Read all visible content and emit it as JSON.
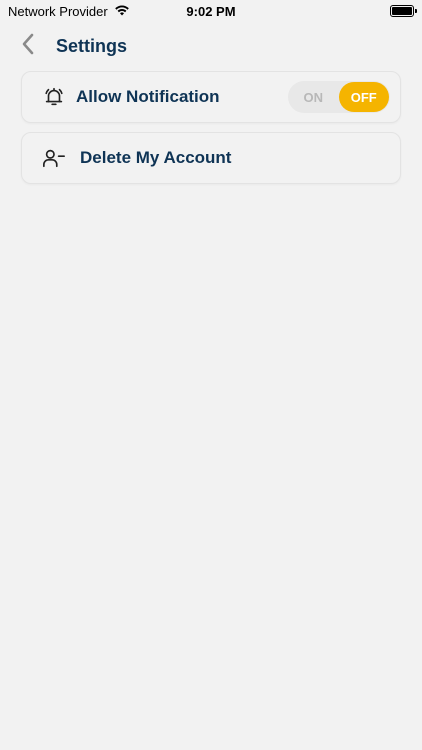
{
  "status_bar": {
    "carrier": "Network Provider",
    "time": "9:02 PM",
    "wifi_icon": "wifi-icon",
    "battery_icon": "battery-icon"
  },
  "header": {
    "back_icon": "chevron-left-icon",
    "title": "Settings"
  },
  "settings": {
    "notification": {
      "icon": "bell-ring-icon",
      "label": "Allow Notification",
      "toggle": {
        "on_label": "ON",
        "off_label": "OFF",
        "selected": "OFF",
        "accent_color": "#f5b400"
      }
    },
    "delete_account": {
      "icon": "user-minus-icon",
      "label": "Delete My Account"
    }
  },
  "colors": {
    "background": "#f2f2f2",
    "text_primary": "#0f3455",
    "accent": "#f5b400"
  }
}
